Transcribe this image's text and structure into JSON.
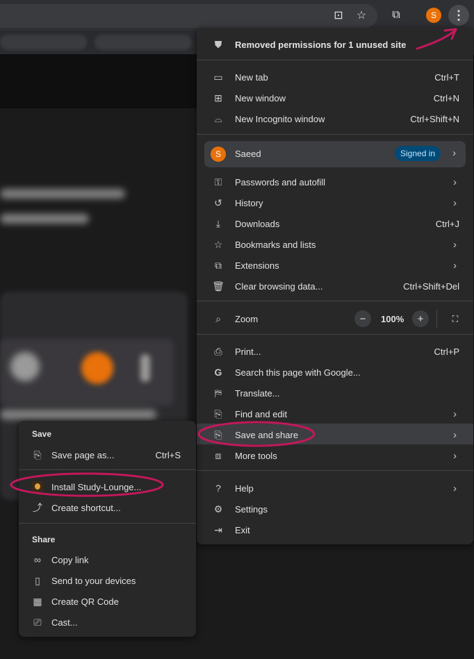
{
  "browser": {
    "toolbar": {
      "install_icon": "install-app-icon",
      "bookmark_icon": "star-icon",
      "extensions_icon": "puzzle-icon",
      "avatar_letter": "S",
      "menu_icon": "three-dots-vertical-icon"
    }
  },
  "menu": {
    "notice": "Removed permissions for 1 unused site",
    "new_tab": {
      "label": "New tab",
      "shortcut": "Ctrl+T"
    },
    "new_window": {
      "label": "New window",
      "shortcut": "Ctrl+N"
    },
    "new_incognito": {
      "label": "New Incognito window",
      "shortcut": "Ctrl+Shift+N"
    },
    "profile": {
      "letter": "S",
      "name": "Saeed",
      "badge": "Signed in"
    },
    "passwords": {
      "label": "Passwords and autofill"
    },
    "history": {
      "label": "History"
    },
    "downloads": {
      "label": "Downloads",
      "shortcut": "Ctrl+J"
    },
    "bookmarks": {
      "label": "Bookmarks and lists"
    },
    "extensions": {
      "label": "Extensions"
    },
    "clear_data": {
      "label": "Clear browsing data...",
      "shortcut": "Ctrl+Shift+Del"
    },
    "zoom": {
      "label": "Zoom",
      "minus": "−",
      "value": "100%",
      "plus": "+"
    },
    "print": {
      "label": "Print...",
      "shortcut": "Ctrl+P"
    },
    "search_google": {
      "label": "Search this page with Google..."
    },
    "translate": {
      "label": "Translate..."
    },
    "find_edit": {
      "label": "Find and edit"
    },
    "save_share": {
      "label": "Save and share"
    },
    "more_tools": {
      "label": "More tools"
    },
    "help": {
      "label": "Help"
    },
    "settings": {
      "label": "Settings"
    },
    "exit": {
      "label": "Exit"
    }
  },
  "submenu": {
    "save_header": "Save",
    "save_page": {
      "label": "Save page as...",
      "shortcut": "Ctrl+S"
    },
    "install": {
      "label": "Install Study-Lounge..."
    },
    "create_shortcut": {
      "label": "Create shortcut..."
    },
    "share_header": "Share",
    "copy_link": {
      "label": "Copy link"
    },
    "send_devices": {
      "label": "Send to your devices"
    },
    "qr_code": {
      "label": "Create QR Code"
    },
    "cast": {
      "label": "Cast..."
    }
  },
  "colors": {
    "menu_bg": "#282828",
    "annotation": "#c2185b",
    "avatar": "#e8710a",
    "signed_in_bg": "#004a77"
  }
}
